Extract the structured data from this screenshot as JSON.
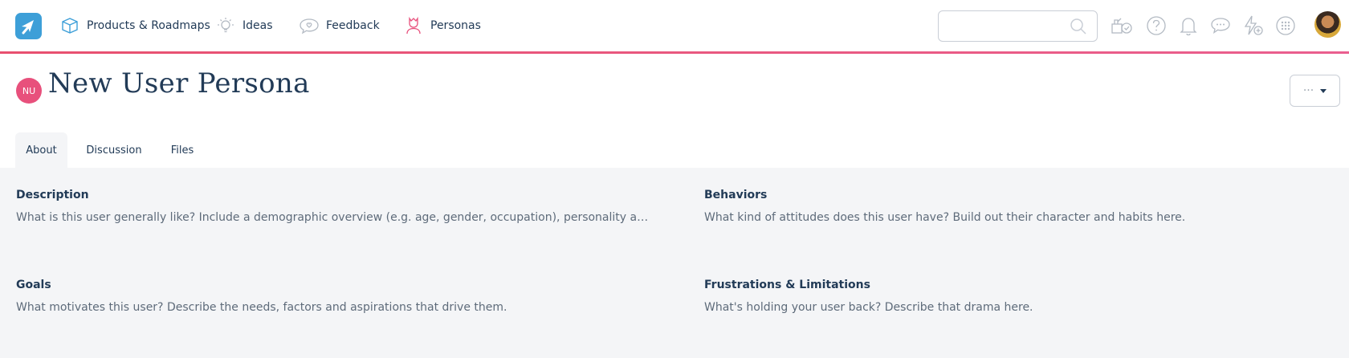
{
  "nav": {
    "items": [
      {
        "label": "Products & Roadmaps",
        "icon": "box-icon"
      },
      {
        "label": "Ideas",
        "icon": "lightbulb-icon"
      },
      {
        "label": "Feedback",
        "icon": "chat-heart-icon"
      },
      {
        "label": "Personas",
        "icon": "persona-icon"
      }
    ],
    "search": {
      "placeholder": ""
    },
    "icons": [
      "whats-new-icon",
      "help-icon",
      "bell-icon",
      "chat-icon",
      "bolt-add-icon",
      "apps-grid-icon"
    ]
  },
  "persona": {
    "initials": "NU",
    "title": "New User Persona",
    "more_label": "···"
  },
  "tabs": [
    {
      "label": "About",
      "active": true
    },
    {
      "label": "Discussion",
      "active": false
    },
    {
      "label": "Files",
      "active": false
    }
  ],
  "sections": [
    {
      "heading": "Description",
      "text": "What is this user generally like? Include a demographic overview (e.g. age, gender, occupation), personality and any disti..."
    },
    {
      "heading": "Behaviors",
      "text": "What kind of attitudes does this user have? Build out their character and habits here."
    },
    {
      "heading": "Goals",
      "text": "What motivates this user? Describe the needs, factors and aspirations that drive them."
    },
    {
      "heading": "Frustrations & Limitations",
      "text": "What's holding your user back? Describe that drama here."
    }
  ],
  "colors": {
    "accent": "#e8507c",
    "brand": "#3d9fd8",
    "text": "#223b57",
    "muted": "#5e6b7a"
  }
}
